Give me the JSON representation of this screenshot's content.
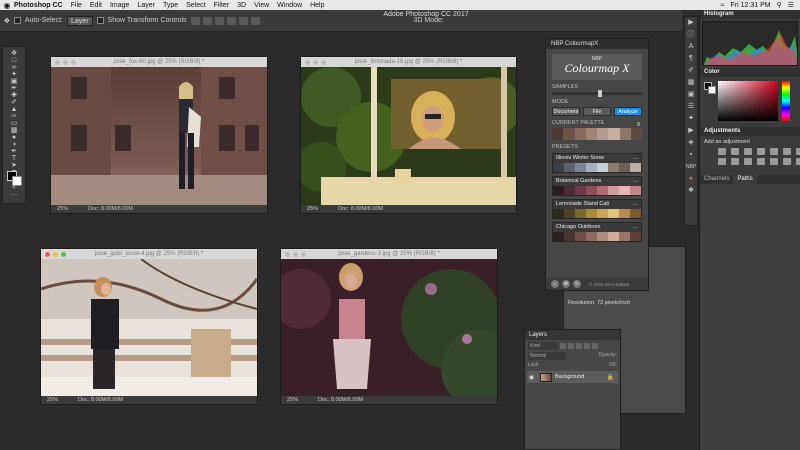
{
  "menubar": {
    "apple": "",
    "app": "Photoshop CC",
    "items": [
      "File",
      "Edit",
      "Image",
      "Layer",
      "Type",
      "Select",
      "Filter",
      "3D",
      "View",
      "Window",
      "Help"
    ],
    "clock": "Fri 12:31 PM"
  },
  "window_title": "Adobe Photoshop CC 2017",
  "options": {
    "auto_select": "Auto-Select:",
    "layer_select": "Layer",
    "transform": "Show Transform Controls",
    "mode_3d": "3D Mode:"
  },
  "docs": [
    {
      "title": "josie_fox-60.jpg @ 25% (RGB/8) *",
      "zoom": "25%",
      "doc": "Doc: 8.00M/8.00M"
    },
    {
      "title": "josie_limonada-16.jpg @ 25% (RGB/8) *",
      "zoom": "25%",
      "doc": "Doc: 8.00M/8.00M"
    },
    {
      "title": "josie_gobi_snow-4.jpg @ 25% (RGB/8) *",
      "zoom": "25%",
      "doc": "Doc: 8.00M/8.00M"
    },
    {
      "title": "josie_gardens-3.jpg @ 25% (RGB/8) *",
      "zoom": "25%",
      "doc": "Doc: 8.00M/8.00M"
    }
  ],
  "nbp": {
    "header": "NBP ColourmapX",
    "logo_small": "NBP",
    "logo_big": "Colourmap X",
    "samples_label": "SAMPLES",
    "samples_value": "8",
    "mode_label": "MODE",
    "modes": [
      "Document",
      "File",
      "Analyze"
    ],
    "active_mode": "Analyze",
    "current_palette_label": "CURRENT PALETTE",
    "current_palette": [
      "#4c3a33",
      "#6e5448",
      "#8a6a5a",
      "#a28473",
      "#b49a8a",
      "#c6b0a2",
      "#8f7566",
      "#5e4a40"
    ],
    "presets_label": "PRESETS",
    "presets": [
      {
        "name": "Illinois Winter Snow",
        "colors": [
          "#3a3f4a",
          "#5a6170",
          "#7d8796",
          "#a7b1bd",
          "#c7cfd9",
          "#8a7a6f",
          "#6a5e58",
          "#b9aea6"
        ]
      },
      {
        "name": "Botanical Gardens",
        "colors": [
          "#2d1a22",
          "#4a2a36",
          "#6a3a48",
          "#8d4f5c",
          "#b06d78",
          "#d39aa0",
          "#e2b6b5",
          "#c0868c"
        ]
      },
      {
        "name": "Lemonade Stand Cali",
        "colors": [
          "#2c2a16",
          "#4b4220",
          "#7a6a2c",
          "#a88a3a",
          "#c9a654",
          "#e0c27a",
          "#b58c50",
          "#7b5a30"
        ]
      },
      {
        "name": "Chicago Outdoors",
        "colors": [
          "#2a2020",
          "#4a3430",
          "#6e4e46",
          "#8e6a5e",
          "#b08c7e",
          "#cfae9e",
          "#9c7466",
          "#5c4038"
        ]
      }
    ],
    "copyright": "© 2016 Nino Batista"
  },
  "info": {
    "resolution": "Resolution: 72 pixels/inch"
  },
  "layers": {
    "header": "Layers",
    "kind": "Kind",
    "blend": "Normal",
    "opacity": "Opacity:",
    "lock": "Lock:",
    "fill": "Fill:",
    "layer_name": "Background"
  },
  "panels": {
    "histogram": "Histogram",
    "color": "Color",
    "adjustments": "Adjustments",
    "add_adjustment": "Add an adjustment",
    "channels": "Channels",
    "paths": "Paths"
  },
  "colors": {
    "accent": "#1d8ee8",
    "ps_bg": "#2b2b2b"
  },
  "icons": [
    "apple-icon",
    "wifi-icon",
    "search-icon",
    "menu-icon",
    "move-tool-icon",
    "eye-icon",
    "lock-icon"
  ]
}
